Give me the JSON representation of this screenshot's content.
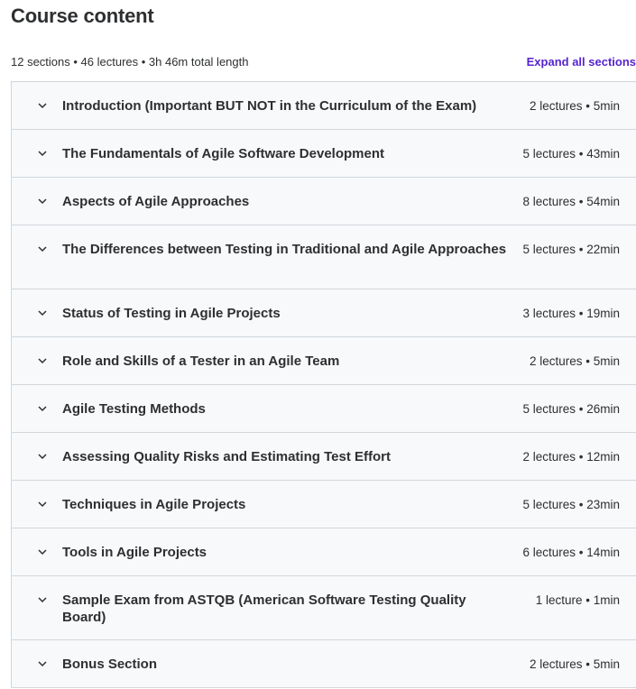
{
  "header": {
    "title": "Course content",
    "summary": "12 sections • 46 lectures • 3h 46m total length",
    "expand_all_label": "Expand all sections"
  },
  "icons": {
    "section_toggle": "chevron-down-icon"
  },
  "colors": {
    "accent": "#5624d0",
    "section_bg": "#f7f9fa",
    "border": "#d1d7dc"
  },
  "sections": [
    {
      "title": "Introduction (Important BUT NOT in the Curriculum of the Exam)",
      "meta": "2 lectures • 5min"
    },
    {
      "title": "The Fundamentals of Agile Software Development",
      "meta": "5 lectures • 43min"
    },
    {
      "title": "Aspects of Agile Approaches",
      "meta": "8 lectures • 54min"
    },
    {
      "title": "The Differences between Testing in Traditional and Agile Approaches",
      "meta": "5 lectures • 22min"
    },
    {
      "title": "Status of Testing in Agile Projects",
      "meta": "3 lectures • 19min"
    },
    {
      "title": "Role and Skills of a Tester in an Agile Team",
      "meta": "2 lectures • 5min"
    },
    {
      "title": "Agile Testing Methods",
      "meta": "5 lectures • 26min"
    },
    {
      "title": "Assessing Quality Risks and Estimating Test Effort",
      "meta": "2 lectures • 12min"
    },
    {
      "title": "Techniques in Agile Projects",
      "meta": "5 lectures • 23min"
    },
    {
      "title": "Tools in Agile Projects",
      "meta": "6 lectures • 14min"
    },
    {
      "title": "Sample Exam from ASTQB (American Software Testing Quality Board)",
      "meta": "1 lecture • 1min"
    },
    {
      "title": "Bonus Section",
      "meta": "2 lectures • 5min"
    }
  ]
}
